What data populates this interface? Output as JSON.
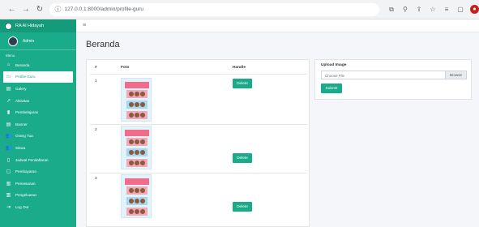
{
  "browser": {
    "url": "127.0.0.1:8000/admin/profile-guru",
    "nav_icons": [
      "back-icon",
      "forward-icon",
      "reload-icon"
    ],
    "tool_icons": [
      "translate-icon",
      "zoom-icon",
      "share-icon",
      "star-icon",
      "reading-list-icon",
      "window-icon",
      "profile-icon"
    ]
  },
  "brand": {
    "title": "RA Al Hidayah"
  },
  "user": {
    "name": "Admin"
  },
  "sidebar": {
    "menu_heading": "Menu",
    "items": [
      {
        "label": "Beranda",
        "icon": "home-icon",
        "glyph": "⌂",
        "active": false
      },
      {
        "label": "Profile Guru",
        "icon": "id-card-icon",
        "glyph": "▭",
        "active": true
      },
      {
        "label": "Galery",
        "icon": "images-icon",
        "glyph": "▤",
        "active": false
      },
      {
        "label": "Aktivitas",
        "icon": "chart-icon",
        "glyph": "↗",
        "active": false
      },
      {
        "label": "Pembelajaran",
        "icon": "book-icon",
        "glyph": "▮",
        "active": false
      },
      {
        "label": "Banner",
        "icon": "banner-icon",
        "glyph": "▤",
        "active": false
      },
      {
        "label": "Orang Tua",
        "icon": "users-icon",
        "glyph": "👥",
        "active": false
      },
      {
        "label": "Siswa",
        "icon": "students-icon",
        "glyph": "👥",
        "active": false
      },
      {
        "label": "Jadwal Pendaftaran",
        "icon": "calendar-icon",
        "glyph": "▯",
        "active": false
      },
      {
        "label": "Pembayaran",
        "icon": "payment-icon",
        "glyph": "▢",
        "active": false
      },
      {
        "label": "Pemesanan",
        "icon": "order-icon",
        "glyph": "▥",
        "active": false
      },
      {
        "label": "Pengeluaran",
        "icon": "expense-icon",
        "glyph": "▥",
        "active": false
      },
      {
        "label": "Log Out",
        "icon": "logout-icon",
        "glyph": "⇥",
        "active": false
      }
    ]
  },
  "page": {
    "title": "Beranda"
  },
  "table": {
    "headers": {
      "no": "#",
      "foto": "Foto",
      "handle": "Handle"
    },
    "rows": [
      {
        "no": "1",
        "delete_label": "Delete"
      },
      {
        "no": "2",
        "delete_label": "Delete"
      },
      {
        "no": "3",
        "delete_label": "Delete"
      }
    ]
  },
  "upload": {
    "label": "Upload Image",
    "placeholder": "Choose File",
    "browse_label": "Browse",
    "submit_label": "Submit"
  },
  "colors": {
    "accent": "#1aab8a",
    "content_bg": "#f4f6f9"
  }
}
